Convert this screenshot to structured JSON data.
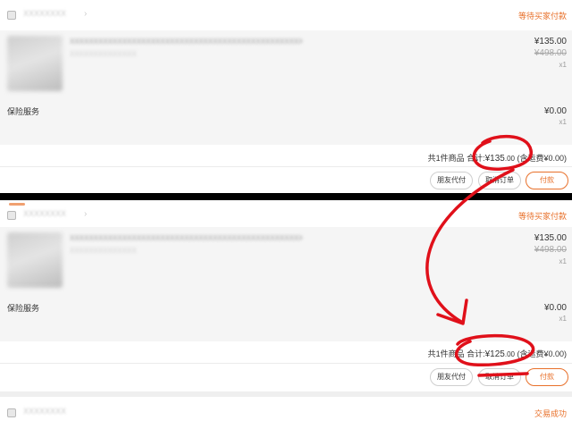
{
  "orders": [
    {
      "shop_name": "XXXXXXXX",
      "status": "等待买家付款",
      "item_title": "XXXXXXXXXXXXXXXXXXXXXXXXXXXXXXXXXXXXXXXXXXXXXXXXXXXXXX",
      "item_subtitle": "XXXXXXXXXXXXXX",
      "price": "¥135.00",
      "original_price": "¥498.00",
      "qty": "x1",
      "insurance_label": "保险服务",
      "insurance_price": "¥0.00",
      "insurance_qty": "x1",
      "summary_prefix": "共1件商品 合计:",
      "summary_int": "¥135",
      "summary_dec": ".00",
      "summary_ship": " (含运费¥0.00)",
      "buttons": [
        "朋友代付",
        "取消订单",
        "付款"
      ]
    },
    {
      "shop_name": "XXXXXXXX",
      "status": "等待买家付款",
      "item_title": "XXXXXXXXXXXXXXXXXXXXXXXXXXXXXXXXXXXXXXXXXXXXXXXXXXXXXX",
      "item_subtitle": "XXXXXXXXXXXXXX",
      "price": "¥135.00",
      "original_price": "¥498.00",
      "qty": "x1",
      "insurance_label": "保险服务",
      "insurance_price": "¥0.00",
      "insurance_qty": "x1",
      "summary_prefix": "共1件商品 合计:",
      "summary_int": "¥125",
      "summary_dec": ".00",
      "summary_ship": " (含运费¥0.00)",
      "buttons": [
        "朋友代付",
        "取消订单",
        "付款"
      ]
    },
    {
      "shop_name": "XXXXXXXX",
      "status": "交易成功"
    }
  ],
  "colors": {
    "accent": "#e8702a",
    "annotation": "#e0101a",
    "divider": "#000000"
  }
}
